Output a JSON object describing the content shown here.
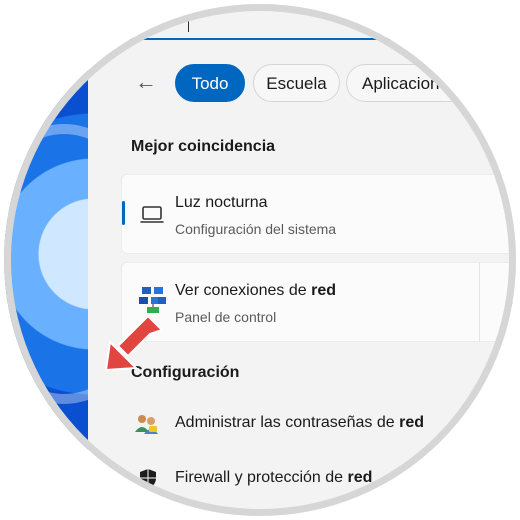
{
  "filters": {
    "back_label": "←",
    "items": [
      "Todo",
      "Escuela",
      "Aplicacion"
    ]
  },
  "best_match": {
    "heading": "Mejor coincidencia",
    "results": [
      {
        "title": "Luz nocturna",
        "subtitle": "Configuración del sistema",
        "icon": "laptop-icon"
      },
      {
        "title_prefix": "Ver conexiones de ",
        "title_bold": "red",
        "subtitle": "Panel de control",
        "icon": "network-connections-icon"
      }
    ],
    "chevron": "›"
  },
  "settings": {
    "heading": "Configuración",
    "items": [
      {
        "prefix": "Administrar las contraseñas de ",
        "bold": "red",
        "icon": "users-credentials-icon"
      },
      {
        "prefix": "Firewall y protección de ",
        "bold": "red",
        "icon": "shield-icon"
      }
    ]
  },
  "colors": {
    "accent": "#0067c0",
    "annotation_arrow": "#e0453f"
  }
}
